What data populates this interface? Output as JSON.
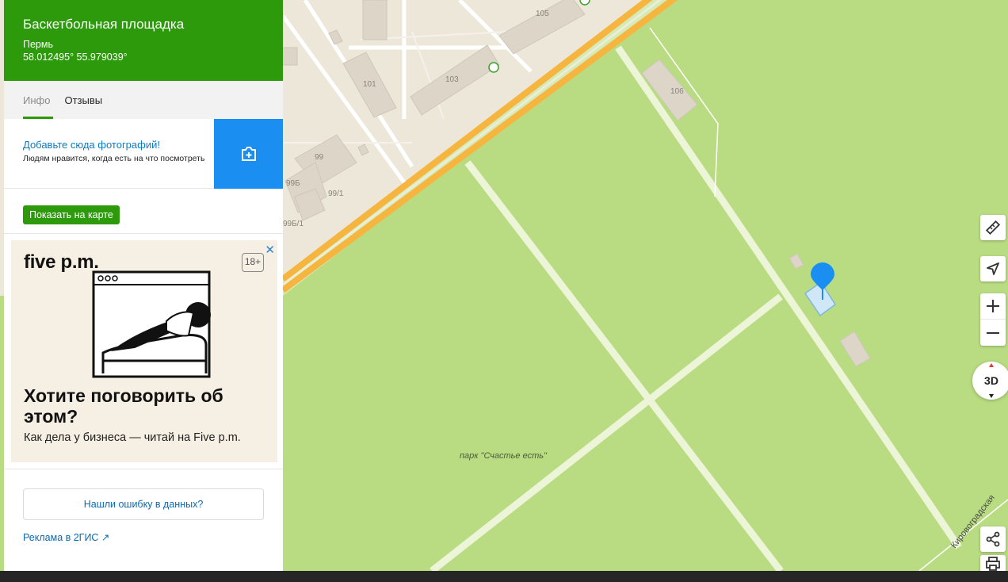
{
  "place": {
    "title": "Баскетбольная площадка",
    "city": "Пермь",
    "coords": "58.012495° 55.979039°"
  },
  "tabs": [
    {
      "label": "Инфо",
      "active": true
    },
    {
      "label": "Отзывы",
      "active": false
    }
  ],
  "photo_prompt": {
    "title": "Добавьте сюда фотографий!",
    "subtitle": "Людям нравится, когда есть на что посмотреть",
    "icon": "camera-add-icon"
  },
  "show_on_map_label": "Показать на карте",
  "ad": {
    "brand": "five p.m.",
    "age": "18+",
    "headline": "Хотите поговорить об этом?",
    "subline": "Как дела у бизнеса — читай на Five p.m.",
    "close_icon": "close-icon"
  },
  "report_error_label": "Нашли ошибку в данных?",
  "advertising_link": "Реклама в 2ГИС ↗",
  "map": {
    "building_labels": [
      "105",
      "101",
      "103",
      "106",
      "99",
      "99Б",
      "99/1",
      "99Б/1"
    ],
    "park_label": "парк \"Счастье есть\"",
    "street_label": "Кировоградская",
    "colors": {
      "park": "#b9dc82",
      "urban": "#ede7da",
      "road": "#f6b53e",
      "path": "#ecf5d8",
      "marker": "#1b8ef2",
      "brand_green": "#2c9a0a"
    }
  },
  "controls": {
    "ruler_icon": "ruler-icon",
    "locate_icon": "navigation-arrow-icon",
    "zoom_in_icon": "plus-icon",
    "zoom_out_icon": "minus-icon",
    "view_3d_label": "3D",
    "share_icon": "share-icon",
    "print_icon": "printer-icon"
  }
}
